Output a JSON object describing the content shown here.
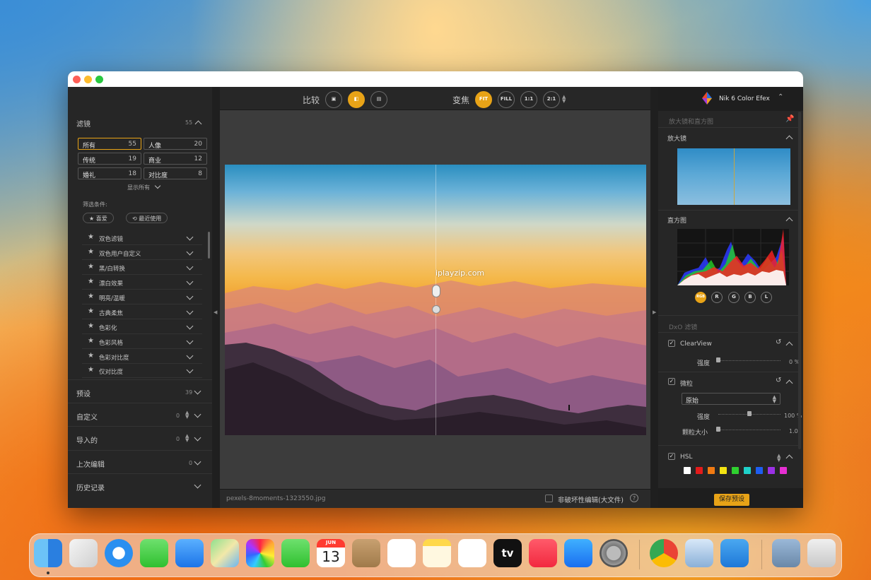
{
  "window": {
    "app_title": "Nik 6 Color Efex"
  },
  "left_panel": {
    "filters_title": "滤镜",
    "filters_count": "55",
    "categories": [
      {
        "label": "所有",
        "count": "55",
        "selected": true
      },
      {
        "label": "人像",
        "count": "20"
      },
      {
        "label": "传统",
        "count": "19"
      },
      {
        "label": "商业",
        "count": "12"
      },
      {
        "label": "婚礼",
        "count": "18"
      },
      {
        "label": "对比度",
        "count": "8"
      }
    ],
    "show_all": "显示所有",
    "filter_conditions": "筛选条件:",
    "favorites": "喜爱",
    "recent": "最近使用",
    "filter_list": [
      "双色滤镜",
      "双色用户自定义",
      "黑/白转换",
      "漂白效果",
      "明亮/温暖",
      "古典柔焦",
      "色彩化",
      "色彩风格",
      "色彩对比度",
      "仅对比度"
    ],
    "sections": [
      {
        "label": "预设",
        "count": "39"
      },
      {
        "label": "自定义",
        "count": "0"
      },
      {
        "label": "导入的",
        "count": "0"
      },
      {
        "label": "上次编辑",
        "count": "0"
      },
      {
        "label": "历史记录",
        "count": ""
      }
    ]
  },
  "toolbar": {
    "compare_label": "比较",
    "zoom_label": "变焦",
    "fit": "FIT",
    "fill": "FILL",
    "one_to_one": "1:1",
    "two_to_one": "2:1"
  },
  "canvas": {
    "watermark": "iplayzip.com",
    "filename": "pexels-8moments-1323550.jpg",
    "nondestructive": "非破坏性编辑(大文件)",
    "help": "?"
  },
  "right_panel": {
    "header_section": "放大镜和直方图",
    "loupe_title": "放大镜",
    "histogram_title": "直方图",
    "channels": [
      "RGB",
      "R",
      "G",
      "B",
      "L"
    ],
    "dxo_filters": "DxO 滤镜",
    "clearview": {
      "title": "ClearView",
      "strength_label": "强度",
      "strength_value": "0 %",
      "strength": 0
    },
    "grain": {
      "title": "微粒",
      "preset": "原始",
      "strength_label": "强度",
      "strength_value": "100 %",
      "strength": 0.5,
      "size_label": "颗粒大小",
      "size_value": "1.0",
      "size": 0
    },
    "hsl": {
      "title": "HSL",
      "colors": [
        "#ffffff",
        "#e31b1b",
        "#f07a12",
        "#f3e312",
        "#2fd02f",
        "#1fd1c9",
        "#1e5ef0",
        "#9b30e6",
        "#e62fd2"
      ]
    },
    "save_preset": "保存预设"
  },
  "colors": {
    "accent": "#e8a317"
  },
  "dock": {
    "icons": [
      "finder-icon",
      "launchpad-icon",
      "safari-icon",
      "messages-icon",
      "mail-icon",
      "maps-icon",
      "photos-icon",
      "facetime-icon",
      "calendar-icon",
      "contacts-icon",
      "reminders-icon",
      "notes-icon",
      "freeform-icon",
      "appletv-icon",
      "music-icon",
      "appstore-icon",
      "settings-icon",
      "chrome-icon",
      "preview-icon",
      "weather-icon",
      "downloads-icon",
      "trash-icon"
    ],
    "calendar_month": "JUN",
    "calendar_day": "13",
    "tv_label": "tv"
  }
}
